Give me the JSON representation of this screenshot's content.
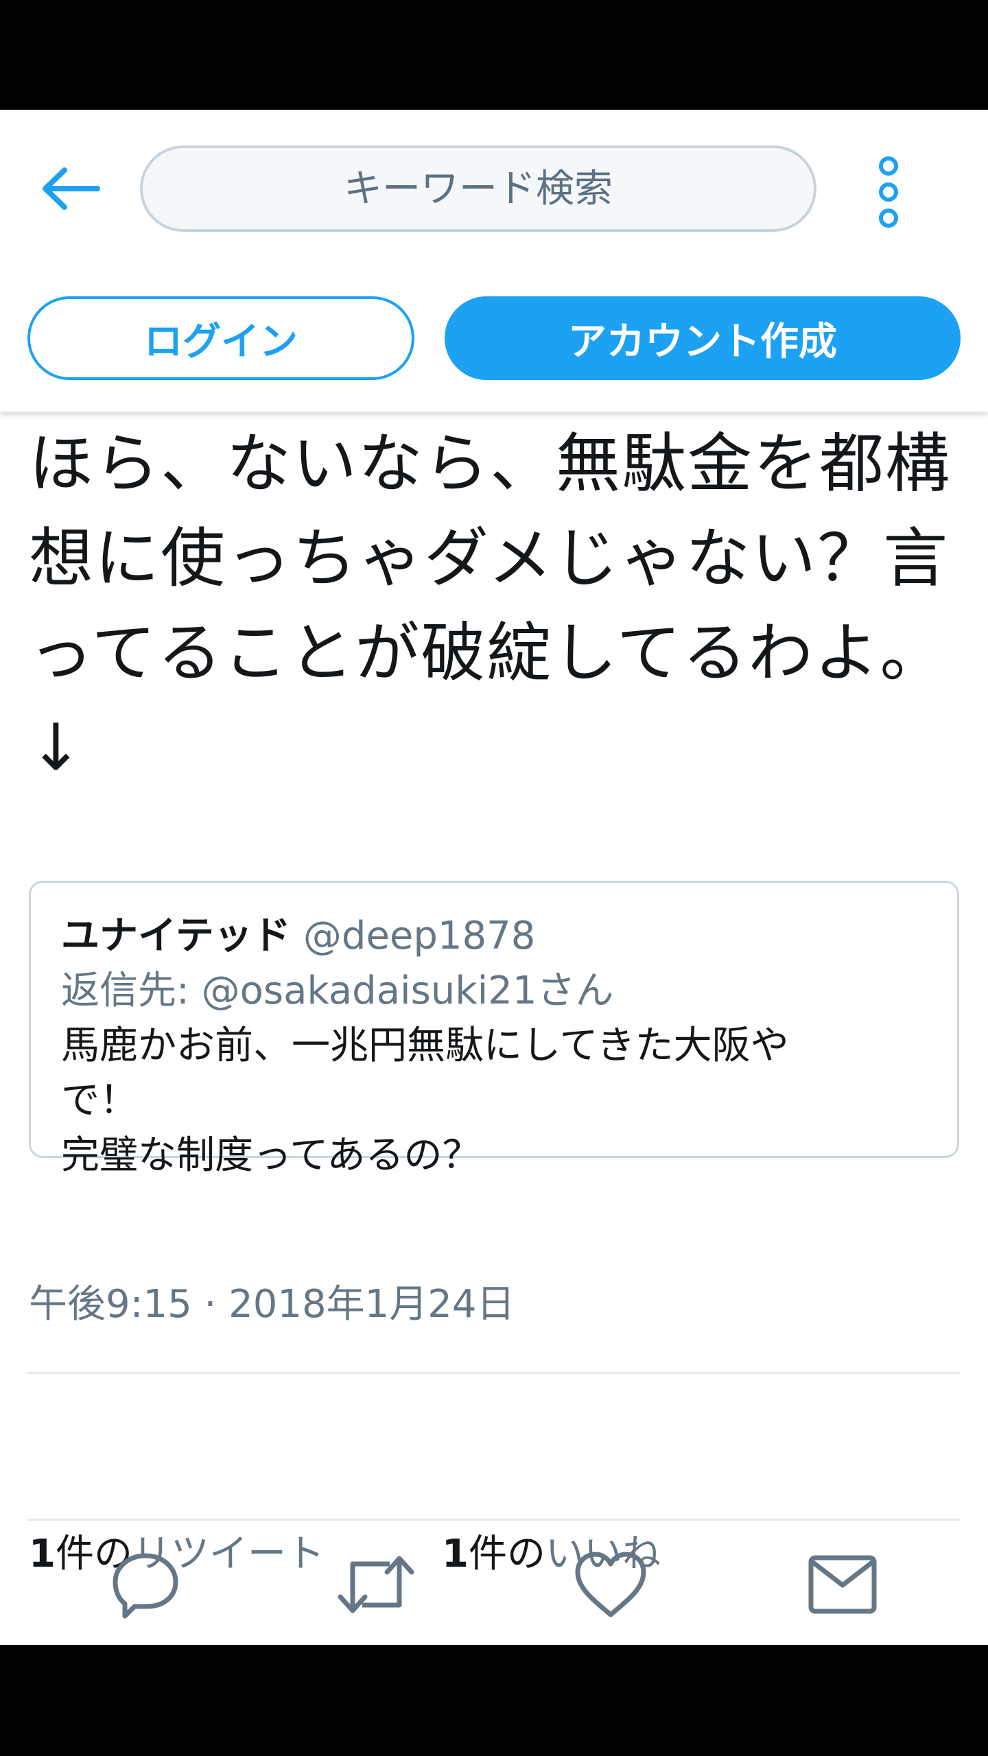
{
  "header": {
    "search_placeholder": "キーワード検索",
    "login_label": "ログイン",
    "signup_label": "アカウント作成"
  },
  "tweet": {
    "text": "ほら、ないなら、無駄金を都構\n想に使っちゃダメじゃない？言\nってることが破綻してるわよ。\n↓",
    "quoted": {
      "name": "ユナイテッド",
      "handle": "@deep1878",
      "reply_to": "返信先: @osakadaisuki21さん",
      "text": "馬鹿かお前、一兆円無駄にしてきた大阪や\nで！\n完璧な制度ってあるの？"
    },
    "timestamp": "午後9:15 · 2018年1月24日",
    "retweets": {
      "count": "1",
      "unit": "件の",
      "label": "リツイート"
    },
    "likes": {
      "count": "1",
      "unit": "件の",
      "label": "いいね"
    }
  },
  "icons": {
    "back": "arrow-left-icon",
    "more": "vertical-dots-icon",
    "reply": "reply-bubble-icon",
    "retweet": "retweet-icon",
    "like": "heart-icon",
    "message": "envelope-icon"
  },
  "colors": {
    "accent": "#1da1f2",
    "text": "#14171a",
    "muted": "#657786",
    "border": "#ccd6dd"
  }
}
